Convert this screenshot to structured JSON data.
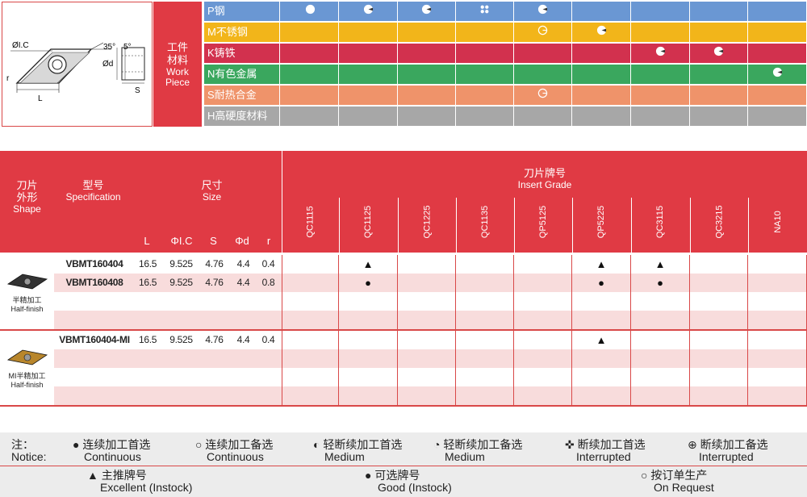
{
  "diagram": {
    "ic_label": "ØI.C",
    "angle1": "35°",
    "angle2": "5°",
    "d_label": "Ød",
    "r_label": "r",
    "l_label": "L",
    "s_label": "S"
  },
  "workpiece": {
    "cn_line1": "工件",
    "cn_line2": "材料",
    "en_line1": "Work",
    "en_line2": "Piece"
  },
  "materials": [
    {
      "name": "P钢",
      "color": "#6a97d3",
      "marks": {
        "QC1115": "full",
        "QC1125": "medium",
        "QC1225": "medium",
        "QC1135": "interrupted",
        "QP5125": "medium"
      }
    },
    {
      "name": "M不锈钢",
      "color": "#f2b51a",
      "marks": {
        "QP5125": "medium_alt",
        "QP5225": "medium"
      }
    },
    {
      "name": "K铸铁",
      "color": "#d2314e",
      "marks": {
        "QC3115": "medium",
        "QC3215": "medium"
      }
    },
    {
      "name": "N有色金属",
      "color": "#3aa75e",
      "marks": {
        "NA10": "medium"
      }
    },
    {
      "name": "S耐热合金",
      "color": "#ef936a",
      "marks": {
        "QP5125": "medium_alt"
      }
    },
    {
      "name": "H高硬度材料",
      "color": "#a7a7a7",
      "marks": {}
    }
  ],
  "grades": [
    "QC1115",
    "QC1125",
    "QC1225",
    "QC1135",
    "QP5125",
    "QP5225",
    "QC3115",
    "QC3215",
    "NA10"
  ],
  "header": {
    "shape_cn1": "刀片",
    "shape_cn2": "外形",
    "shape_en": "Shape",
    "spec_cn": "型号",
    "spec_en": "Specification",
    "size_cn": "尺寸",
    "size_en": "Size",
    "grade_cn": "刀片牌号",
    "grade_en": "Insert Grade",
    "cols": [
      "L",
      "ΦI.C",
      "S",
      "Φd",
      "r"
    ]
  },
  "groups": [
    {
      "shape_cn": "半精加工",
      "shape_en": "Half-finish",
      "insert_color": "#333",
      "rows": [
        {
          "spec": "VBMT160404",
          "L": "16.5",
          "ic": "9.525",
          "s": "4.76",
          "d": "4.4",
          "r": "0.4",
          "marks": {
            "QC1125": "▲",
            "QP5225": "▲",
            "QC3115": "▲"
          }
        },
        {
          "spec": "VBMT160408",
          "L": "16.5",
          "ic": "9.525",
          "s": "4.76",
          "d": "4.4",
          "r": "0.8",
          "marks": {
            "QC1125": "●",
            "QP5225": "●",
            "QC3115": "●"
          }
        },
        {
          "spec": "",
          "L": "",
          "ic": "",
          "s": "",
          "d": "",
          "r": "",
          "marks": {}
        },
        {
          "spec": "",
          "L": "",
          "ic": "",
          "s": "",
          "d": "",
          "r": "",
          "marks": {}
        }
      ]
    },
    {
      "shape_cn": "MI半精加工",
      "shape_en": "Half-finish",
      "insert_color": "#b8862c",
      "rows": [
        {
          "spec": "VBMT160404-MI",
          "L": "16.5",
          "ic": "9.525",
          "s": "4.76",
          "d": "4.4",
          "r": "0.4",
          "marks": {
            "QP5225": "▲"
          }
        },
        {
          "spec": "",
          "L": "",
          "ic": "",
          "s": "",
          "d": "",
          "r": "",
          "marks": {}
        },
        {
          "spec": "",
          "L": "",
          "ic": "",
          "s": "",
          "d": "",
          "r": "",
          "marks": {}
        },
        {
          "spec": "",
          "L": "",
          "ic": "",
          "s": "",
          "d": "",
          "r": "",
          "marks": {}
        }
      ]
    }
  ],
  "legend": {
    "notice_cn": "注：",
    "notice_en": "Notice:",
    "items1": [
      {
        "sym": "●",
        "cn": "连续加工首选",
        "en": "Continuous"
      },
      {
        "sym": "○",
        "cn": "连续加工备选",
        "en": "Continuous"
      },
      {
        "sym": "◐",
        "cn": "轻断续加工首选",
        "en": "Medium"
      },
      {
        "sym": "◔",
        "cn": "轻断续加工备选",
        "en": "Medium"
      },
      {
        "sym": "✜",
        "cn": "断续加工首选",
        "en": "Interrupted"
      },
      {
        "sym": "⊕",
        "cn": "断续加工备选",
        "en": "Interrupted"
      }
    ],
    "items2": [
      {
        "sym": "▲",
        "cn": "主推牌号",
        "en": "Excellent (Instock)"
      },
      {
        "sym": "●",
        "cn": "可选牌号",
        "en": "Good (Instock)"
      },
      {
        "sym": "○",
        "cn": "按订单生产",
        "en": "On Request"
      }
    ]
  }
}
